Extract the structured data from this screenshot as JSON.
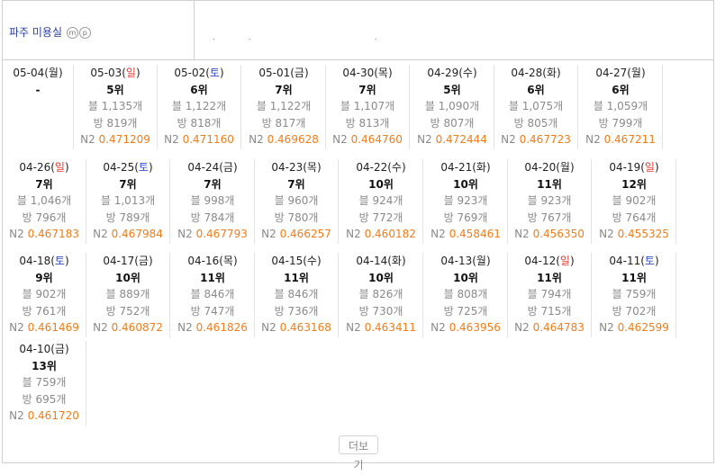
{
  "header": {
    "title": "파주 미용실",
    "badges": [
      "m",
      "p"
    ],
    "dots": [
      ".",
      ".",
      "."
    ]
  },
  "rows": [
    [
      {
        "date": "05-04",
        "dow": "월",
        "dow_type": "normal",
        "rank": "-"
      },
      {
        "date": "05-03",
        "dow": "일",
        "dow_type": "sun",
        "rank": "5위",
        "blog": "블 1,135개",
        "cafe": "방 819개",
        "n2_label": "N2",
        "n2_value": "0.471209"
      },
      {
        "date": "05-02",
        "dow": "토",
        "dow_type": "sat",
        "rank": "6위",
        "blog": "블 1,122개",
        "cafe": "방 818개",
        "n2_label": "N2",
        "n2_value": "0.471160"
      },
      {
        "date": "05-01",
        "dow": "금",
        "dow_type": "normal",
        "rank": "7위",
        "blog": "블 1,122개",
        "cafe": "방 817개",
        "n2_label": "N2",
        "n2_value": "0.469628"
      },
      {
        "date": "04-30",
        "dow": "목",
        "dow_type": "normal",
        "rank": "7위",
        "blog": "블 1,107개",
        "cafe": "방 813개",
        "n2_label": "N2",
        "n2_value": "0.464760"
      },
      {
        "date": "04-29",
        "dow": "수",
        "dow_type": "normal",
        "rank": "5위",
        "blog": "블 1,090개",
        "cafe": "방 807개",
        "n2_label": "N2",
        "n2_value": "0.472444"
      },
      {
        "date": "04-28",
        "dow": "화",
        "dow_type": "normal",
        "rank": "6위",
        "blog": "블 1,075개",
        "cafe": "방 805개",
        "n2_label": "N2",
        "n2_value": "0.467723"
      },
      {
        "date": "04-27",
        "dow": "월",
        "dow_type": "normal",
        "rank": "6위",
        "blog": "블 1,059개",
        "cafe": "방 799개",
        "n2_label": "N2",
        "n2_value": "0.467211"
      }
    ],
    [
      {
        "date": "04-26",
        "dow": "일",
        "dow_type": "sun",
        "rank": "7위",
        "blog": "블 1,046개",
        "cafe": "방 796개",
        "n2_label": "N2",
        "n2_value": "0.467183"
      },
      {
        "date": "04-25",
        "dow": "토",
        "dow_type": "sat",
        "rank": "7위",
        "blog": "블 1,013개",
        "cafe": "방 789개",
        "n2_label": "N2",
        "n2_value": "0.467984"
      },
      {
        "date": "04-24",
        "dow": "금",
        "dow_type": "normal",
        "rank": "7위",
        "blog": "블 998개",
        "cafe": "방 784개",
        "n2_label": "N2",
        "n2_value": "0.467793"
      },
      {
        "date": "04-23",
        "dow": "목",
        "dow_type": "normal",
        "rank": "7위",
        "blog": "블 960개",
        "cafe": "방 780개",
        "n2_label": "N2",
        "n2_value": "0.466257"
      },
      {
        "date": "04-22",
        "dow": "수",
        "dow_type": "normal",
        "rank": "10위",
        "blog": "블 924개",
        "cafe": "방 772개",
        "n2_label": "N2",
        "n2_value": "0.460182"
      },
      {
        "date": "04-21",
        "dow": "화",
        "dow_type": "normal",
        "rank": "10위",
        "blog": "블 923개",
        "cafe": "방 769개",
        "n2_label": "N2",
        "n2_value": "0.458461"
      },
      {
        "date": "04-20",
        "dow": "월",
        "dow_type": "normal",
        "rank": "11위",
        "blog": "블 923개",
        "cafe": "방 767개",
        "n2_label": "N2",
        "n2_value": "0.456350"
      },
      {
        "date": "04-19",
        "dow": "일",
        "dow_type": "sun",
        "rank": "12위",
        "blog": "블 902개",
        "cafe": "방 764개",
        "n2_label": "N2",
        "n2_value": "0.455325"
      }
    ],
    [
      {
        "date": "04-18",
        "dow": "토",
        "dow_type": "sat",
        "rank": "9위",
        "blog": "블 902개",
        "cafe": "방 761개",
        "n2_label": "N2",
        "n2_value": "0.461469"
      },
      {
        "date": "04-17",
        "dow": "금",
        "dow_type": "normal",
        "rank": "10위",
        "blog": "블 889개",
        "cafe": "방 752개",
        "n2_label": "N2",
        "n2_value": "0.460872"
      },
      {
        "date": "04-16",
        "dow": "목",
        "dow_type": "normal",
        "rank": "11위",
        "blog": "블 846개",
        "cafe": "방 747개",
        "n2_label": "N2",
        "n2_value": "0.461826"
      },
      {
        "date": "04-15",
        "dow": "수",
        "dow_type": "normal",
        "rank": "11위",
        "blog": "블 846개",
        "cafe": "방 736개",
        "n2_label": "N2",
        "n2_value": "0.463168"
      },
      {
        "date": "04-14",
        "dow": "화",
        "dow_type": "normal",
        "rank": "10위",
        "blog": "블 826개",
        "cafe": "방 730개",
        "n2_label": "N2",
        "n2_value": "0.463411"
      },
      {
        "date": "04-13",
        "dow": "월",
        "dow_type": "normal",
        "rank": "10위",
        "blog": "블 808개",
        "cafe": "방 725개",
        "n2_label": "N2",
        "n2_value": "0.463956"
      },
      {
        "date": "04-12",
        "dow": "일",
        "dow_type": "sun",
        "rank": "11위",
        "blog": "블 794개",
        "cafe": "방 715개",
        "n2_label": "N2",
        "n2_value": "0.464783"
      },
      {
        "date": "04-11",
        "dow": "토",
        "dow_type": "sat",
        "rank": "11위",
        "blog": "블 759개",
        "cafe": "방 702개",
        "n2_label": "N2",
        "n2_value": "0.462599"
      }
    ],
    [
      {
        "date": "04-10",
        "dow": "금",
        "dow_type": "normal",
        "rank": "13위",
        "blog": "블 759개",
        "cafe": "방 695개",
        "n2_label": "N2",
        "n2_value": "0.461720"
      }
    ]
  ],
  "more_button": "더보기",
  "colors": {
    "sunday": "#e53a2f",
    "saturday": "#2c4fcf",
    "n2_value": "#f07d1a",
    "title": "#2a3ea0"
  }
}
